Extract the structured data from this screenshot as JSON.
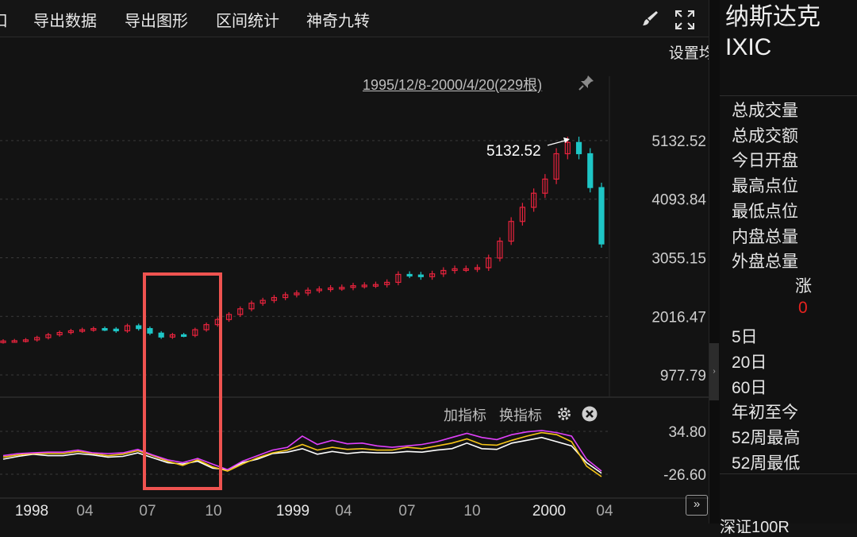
{
  "toolbar": {
    "partial_label": "口",
    "export_data": "导出数据",
    "export_graph": "导出图形",
    "range_stats": "区间统计",
    "magic_nine": "神奇九转"
  },
  "chart": {
    "set_ma": "设置均线",
    "range_text": "1995/12/8-2000/4/20(229根)",
    "peak_label": "5132.52"
  },
  "indicator": {
    "add": "加指标",
    "switch": "换指标"
  },
  "right_panel": {
    "name": "纳斯达克",
    "code": "IXIC",
    "labels": [
      "总成交量",
      "总成交额",
      "今日开盘",
      "最高点位",
      "最低点位",
      "内盘总量",
      "外盘总量"
    ],
    "change_label": "涨",
    "change_value": "0",
    "periods": [
      "5日",
      "20日",
      "60日",
      "年初至今",
      "52周最高",
      "52周最低"
    ],
    "footer": "深证100R"
  },
  "colors": {
    "up": "#e8233d",
    "down": "#1ec6c6",
    "highlight": "#ef5350",
    "line_white": "#ffffff",
    "line_yellow": "#f5c518",
    "line_magenta": "#e040fb"
  },
  "chart_data": {
    "type": "candlestick",
    "price_axis_ticks": [
      "5132.52",
      "4093.84",
      "3055.15",
      "2016.47",
      "977.79"
    ],
    "indicator_axis_ticks": [
      "34.80",
      "-26.60"
    ],
    "x_tick_labels": [
      "1998",
      "04",
      "07",
      "10",
      "1999",
      "04",
      "07",
      "10",
      "2000",
      "04"
    ],
    "price_range": [
      977.79,
      5132.52
    ],
    "indicator_range": [
      -26.6,
      34.8
    ],
    "close_series": [
      1580,
      1585,
      1600,
      1640,
      1690,
      1730,
      1760,
      1780,
      1800,
      1790,
      1760,
      1850,
      1800,
      1720,
      1650,
      1690,
      1680,
      1780,
      1870,
      1960,
      2050,
      2150,
      2250,
      2300,
      2350,
      2400,
      2430,
      2480,
      2500,
      2520,
      2530,
      2560,
      2570,
      2580,
      2620,
      2760,
      2750,
      2720,
      2770,
      2830,
      2860,
      2860,
      2880,
      3050,
      3350,
      3700,
      3950,
      4200,
      4450,
      4900,
      5100,
      4900,
      4300,
      3300
    ],
    "indicator_series": [
      {
        "values": [
          -5,
          -1,
          2,
          0,
          0,
          3,
          1,
          -2,
          -1,
          4,
          -3,
          -10,
          -12,
          -8,
          -18,
          -20,
          -10,
          -5,
          3,
          5,
          10,
          2,
          6,
          3,
          5,
          4,
          4,
          6,
          5,
          8,
          10,
          18,
          10,
          9,
          18,
          22,
          26,
          20,
          14,
          -10,
          -25
        ]
      },
      {
        "values": [
          -2,
          1,
          3,
          3,
          3,
          6,
          3,
          0,
          2,
          7,
          0,
          -8,
          -14,
          -6,
          -16,
          -22,
          -12,
          -3,
          4,
          8,
          16,
          8,
          12,
          9,
          10,
          8,
          8,
          12,
          10,
          14,
          18,
          24,
          16,
          15,
          22,
          28,
          33,
          30,
          20,
          -15,
          -30
        ]
      },
      {
        "values": [
          0,
          3,
          4,
          5,
          5,
          8,
          4,
          3,
          4,
          9,
          1,
          -6,
          -10,
          -4,
          -12,
          -20,
          -8,
          0,
          8,
          12,
          28,
          16,
          22,
          17,
          18,
          14,
          12,
          14,
          16,
          20,
          26,
          32,
          26,
          23,
          30,
          34,
          36,
          33,
          28,
          -5,
          -22
        ]
      }
    ],
    "highlight_box": "selected range in the chart area and indicator panel"
  }
}
